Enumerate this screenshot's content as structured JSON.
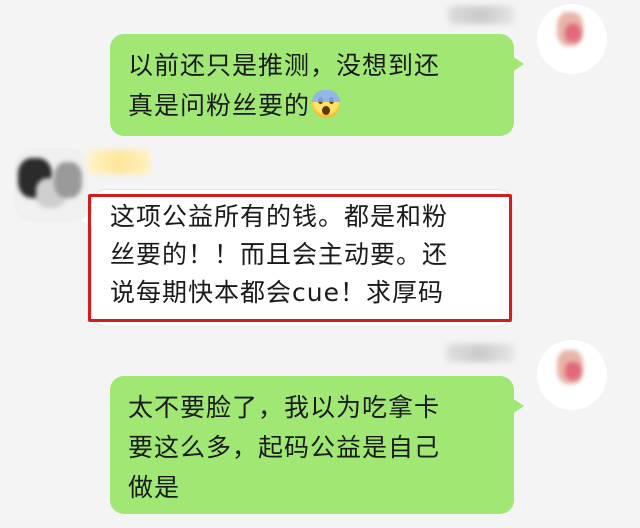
{
  "messages": [
    {
      "side": "self",
      "lines": [
        "以前还只是推测，没想到还",
        "真是问粉丝要的"
      ],
      "emoji": "screaming-face-emoji"
    },
    {
      "side": "other",
      "lines": [
        "这项公益所有的钱。都是和粉",
        "丝要的！！而且会主动要。还",
        "说每期快本都会cue！求厚码"
      ],
      "highlighted": true
    },
    {
      "side": "self",
      "lines": [
        "太不要脸了，我以为吃拿卡",
        "要这么多，起码公益是自己",
        "做是"
      ]
    }
  ],
  "colors": {
    "self_bubble": "#a0e774",
    "other_bubble": "#ffffff",
    "highlight": "#d01e1e",
    "background": "#f4f4f4"
  }
}
